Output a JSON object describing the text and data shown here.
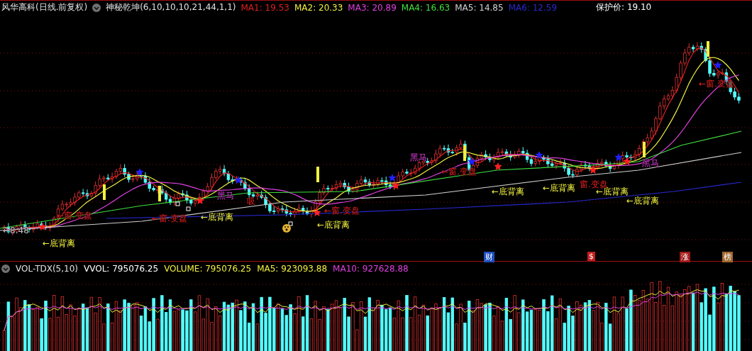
{
  "header": {
    "stock": "风华高科(日线.前复权)",
    "indicator": "神秘乾坤(6,10,10,10,21,44,1,1)",
    "ma_values": [
      {
        "label": "MA1: 19.53",
        "color": "#e02020"
      },
      {
        "label": "MA2: 20.33",
        "color": "#f0f040"
      },
      {
        "label": "MA3: 20.89",
        "color": "#e040e0"
      },
      {
        "label": "MA4: 16.63",
        "color": "#40e040"
      },
      {
        "label": "MA5: 14.85",
        "color": "#d0d0d0"
      },
      {
        "label": "MA6: 12.59",
        "color": "#2828d0"
      }
    ],
    "protect_price": "保护价: 19.10"
  },
  "annotations": [
    {
      "text": "←8.48",
      "kind": "price"
    },
    {
      "text": "←底背离",
      "kind": "divergence"
    },
    {
      "text": "←窗.变盘",
      "kind": "window"
    },
    {
      "text": "←窗.变盘",
      "kind": "window"
    },
    {
      "text": "黑马",
      "kind": "horse"
    },
    {
      "text": "←底背离",
      "kind": "divergence"
    },
    {
      "text": "吸",
      "kind": "window"
    },
    {
      "text": "←窗.变盘",
      "kind": "window"
    },
    {
      "text": "←底背离",
      "kind": "divergence"
    },
    {
      "text": "←窗.变盘",
      "kind": "window"
    },
    {
      "text": "黑马",
      "kind": "horse"
    },
    {
      "text": "←底背离",
      "kind": "divergence"
    },
    {
      "text": "←底背离",
      "kind": "divergence"
    },
    {
      "text": "窗.变盘",
      "kind": "window"
    },
    {
      "text": "←底背离",
      "kind": "divergence"
    },
    {
      "text": "黑马",
      "kind": "horse"
    },
    {
      "text": "←底背离",
      "kind": "divergence"
    },
    {
      "text": "←窗.变盘",
      "kind": "window"
    }
  ],
  "event_markers": [
    {
      "text": "财",
      "color": "#2050c0"
    },
    {
      "text": "$",
      "color": "#c02020"
    },
    {
      "text": "涨",
      "color": "#a01818"
    },
    {
      "text": "榜",
      "color": "#a06830"
    }
  ],
  "volume": {
    "name": "VOL-TDX(5,10)",
    "values": [
      {
        "label": "VVOL: 795076.25",
        "color": "#ffffff"
      },
      {
        "label": "VOLUME: 795076.25",
        "color": "#f0f040"
      },
      {
        "label": "MA5: 923093.88",
        "color": "#f0f040"
      },
      {
        "label": "MA10: 927628.88",
        "color": "#e040e0"
      }
    ]
  }
}
